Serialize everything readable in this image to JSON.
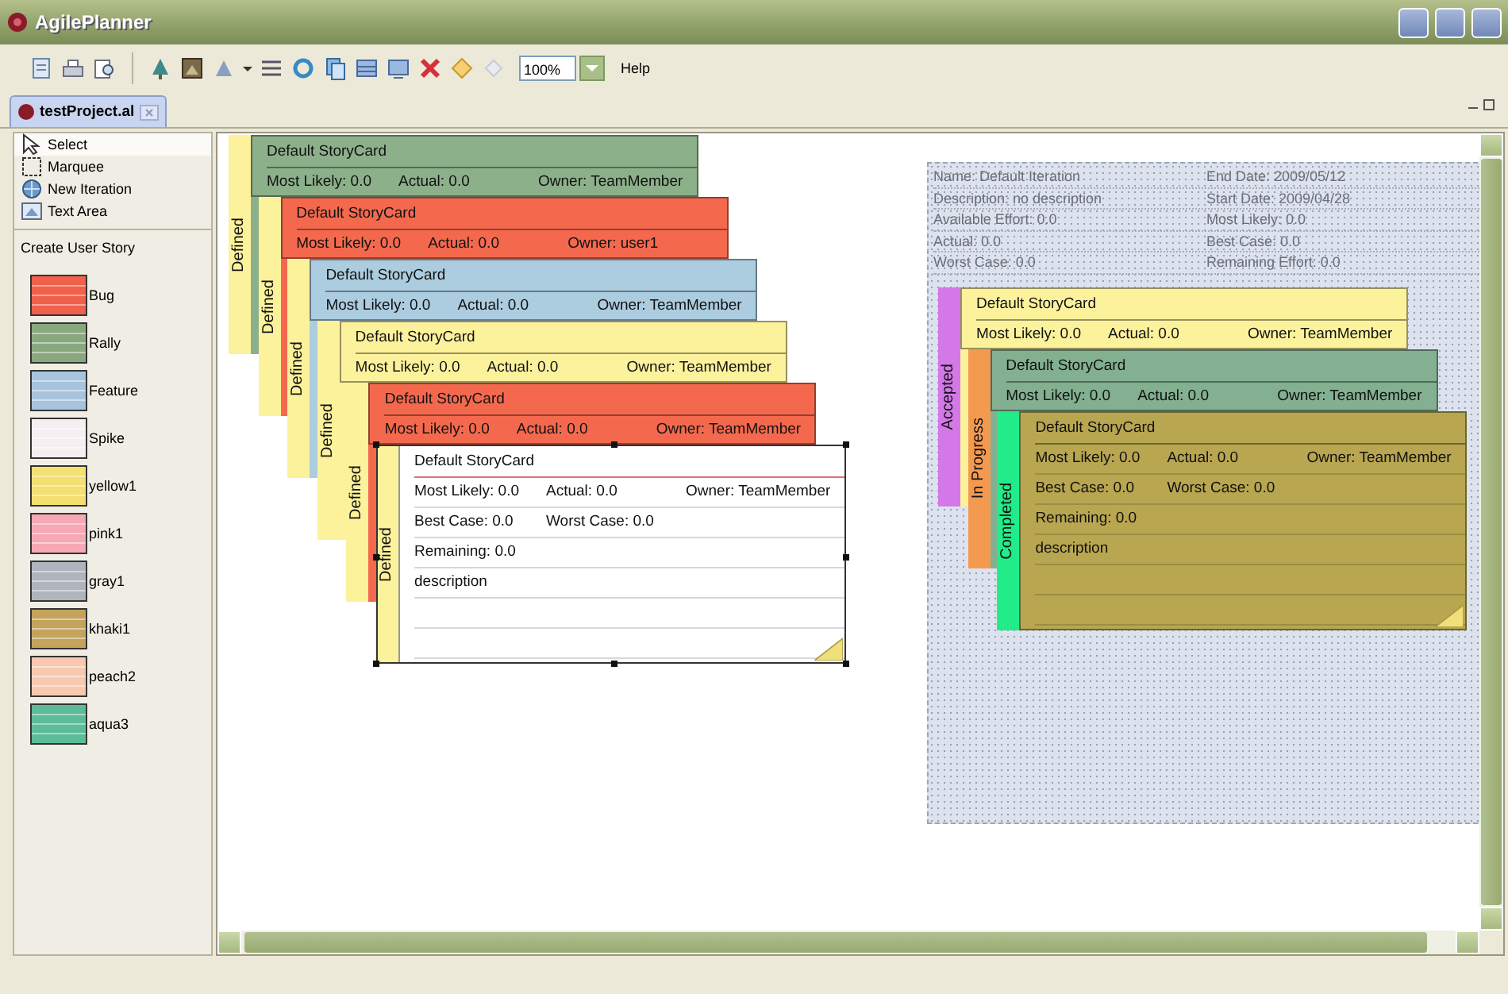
{
  "window": {
    "title": "AgilePlanner"
  },
  "toolbar": {
    "zoom": "100%",
    "help": "Help"
  },
  "editor_tab": {
    "label": "testProject.al",
    "selected": true
  },
  "palette": {
    "tools": [
      {
        "label": "Select",
        "kind": "select",
        "selected": true
      },
      {
        "label": "Marquee",
        "kind": "marquee",
        "selected": false
      },
      {
        "label": "New Iteration",
        "kind": "iteration",
        "selected": false
      },
      {
        "label": "Text Area",
        "kind": "textarea",
        "selected": false
      }
    ],
    "section": "Create User Story",
    "story_types": [
      {
        "label": "Bug",
        "color": "#f0604a"
      },
      {
        "label": "Rally",
        "color": "#8aa87e"
      },
      {
        "label": "Feature",
        "color": "#a8c4dc"
      },
      {
        "label": "Spike",
        "color": "#f6eef0"
      },
      {
        "label": "yellow1",
        "color": "#f4e070"
      },
      {
        "label": "pink1",
        "color": "#f6a8b4"
      },
      {
        "label": "gray1",
        "color": "#b0b4bc"
      },
      {
        "label": "khaki1",
        "color": "#c4a45c"
      },
      {
        "label": "peach2",
        "color": "#f8c8b0"
      },
      {
        "label": "aqua3",
        "color": "#5cbc98"
      }
    ]
  },
  "backlog_cards": [
    {
      "status": {
        "label": "Defined",
        "color": "#fcf29c"
      },
      "color": "#8cb08a",
      "selected": false,
      "title": "Default StoryCard",
      "rows": [
        [
          "Most Likely:  0.0",
          "Actual:  0.0",
          "Owner:  TeamMember"
        ]
      ]
    },
    {
      "status": {
        "label": "Defined",
        "color": "#fcf29c"
      },
      "color": "#f4694e",
      "selected": false,
      "title": "Default StoryCard",
      "rows": [
        [
          "Most Likely:  0.0",
          "Actual:  0.0",
          "Owner:  user1"
        ]
      ]
    },
    {
      "status": {
        "label": "Defined",
        "color": "#fcf29c"
      },
      "color": "#acccdf",
      "selected": false,
      "title": "Default StoryCard",
      "rows": [
        [
          "Most Likely:  0.0",
          "Actual:  0.0",
          "Owner:  TeamMember"
        ]
      ]
    },
    {
      "status": {
        "label": "Defined",
        "color": "#fcf29c"
      },
      "color": "#fcf29c",
      "selected": false,
      "title": "Default StoryCard",
      "rows": [
        [
          "Most Likely:  0.0",
          "Actual:  0.0",
          "Owner:  TeamMember"
        ]
      ]
    },
    {
      "status": {
        "label": "Defined",
        "color": "#fcf29c"
      },
      "color": "#f4694e",
      "selected": false,
      "title": "Default StoryCard",
      "rows": [
        [
          "Most Likely:  0.0",
          "Actual:  0.0",
          "Owner:  TeamMember"
        ]
      ]
    },
    {
      "status": {
        "label": "Defined",
        "color": "#fcf29c"
      },
      "color": "#ffffff",
      "selected": true,
      "title": "Default StoryCard",
      "rows": [
        [
          "Most Likely:  0.0",
          "Actual:  0.0",
          "Owner:  TeamMember"
        ],
        [
          "Best Case:  0.0",
          "Worst Case: 0.0"
        ],
        [
          "Remaining:  0.0"
        ],
        [
          "description"
        ]
      ]
    }
  ],
  "iteration": {
    "info": [
      [
        "Name: Default Iteration",
        "End Date: 2009/05/12"
      ],
      [
        "Description: no description",
        "Start Date: 2009/04/28"
      ],
      [
        "Available Effort: 0.0",
        "Most Likely: 0.0"
      ],
      [
        "Actual: 0.0",
        "Best Case: 0.0"
      ],
      [
        "Worst Case: 0.0",
        "Remaining Effort: 0.0"
      ]
    ],
    "cards": [
      {
        "status": {
          "label": "Accepted",
          "color": "#d478e8"
        },
        "color": "#fcf29c",
        "selected": false,
        "title": "Default StoryCard",
        "rows": [
          [
            "Most Likely:  0.0",
            "Actual:  0.0",
            "Owner:  TeamMember"
          ]
        ]
      },
      {
        "status": {
          "label": "In Progress",
          "color": "#f49a50"
        },
        "color": "#82b090",
        "selected": false,
        "title": "Default StoryCard",
        "rows": [
          [
            "Most Likely:  0.0",
            "Actual:  0.0",
            "Owner:  TeamMember"
          ]
        ]
      },
      {
        "status": {
          "label": "Completed",
          "color": "#22ec8a"
        },
        "color": "#b8a650",
        "selected": false,
        "title": "Default StoryCard",
        "rows": [
          [
            "Most Likely:  0.0",
            "Actual:  0.0",
            "Owner:  TeamMember"
          ],
          [
            "Best Case:  0.0",
            "Worst Case: 0.0"
          ],
          [
            "Remaining:  0.0"
          ],
          [
            "description"
          ]
        ]
      }
    ]
  }
}
